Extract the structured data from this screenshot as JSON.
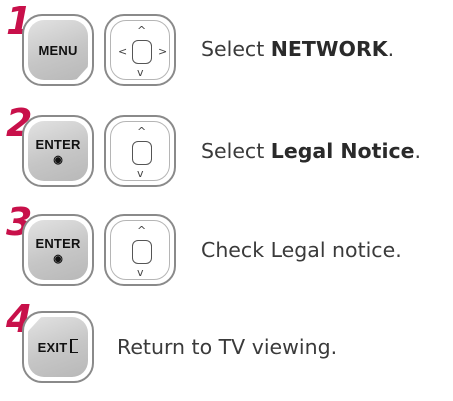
{
  "steps": [
    {
      "number": "1",
      "key_label": "MENU",
      "nav_arrows": [
        "up",
        "down",
        "left",
        "right"
      ],
      "prefix": "Select ",
      "bold": "NETWORK",
      "suffix": "."
    },
    {
      "number": "2",
      "key_label": "ENTER",
      "key_symbol": "◉",
      "nav_arrows": [
        "up",
        "down"
      ],
      "prefix": "Select ",
      "bold": "Legal Notice",
      "suffix": "."
    },
    {
      "number": "3",
      "key_label": "ENTER",
      "key_symbol": "◉",
      "nav_arrows": [
        "up",
        "down"
      ],
      "text": "Check Legal notice."
    },
    {
      "number": "4",
      "key_label": "EXIT",
      "text": "Return to TV viewing."
    }
  ],
  "colors": {
    "step_number": "#c8104a",
    "text": "#3a3a3a",
    "button_face": "#c6c6c6",
    "button_border": "#8a8a8a"
  }
}
